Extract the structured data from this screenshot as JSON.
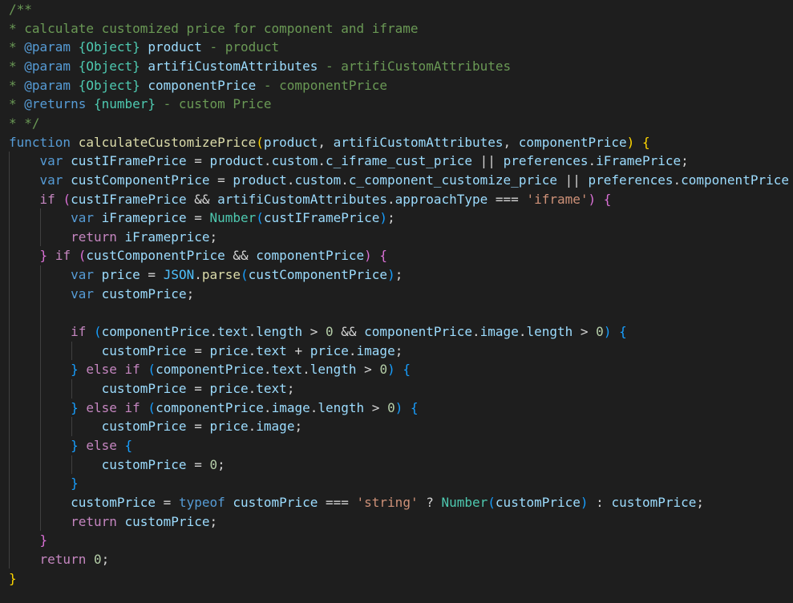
{
  "editor": {
    "theme_colors": {
      "background": "#1e1e1e",
      "comment": "#6a9955",
      "keyword": "#569cd6",
      "control": "#c586c0",
      "function": "#dcdcaa",
      "variable": "#9cdcfe",
      "string": "#ce9178",
      "number": "#b5cea8",
      "type": "#4ec9b0",
      "bracket_level_1": "#ffd700",
      "bracket_level_2": "#da70d6",
      "bracket_level_3": "#179fff"
    },
    "lines": [
      [
        [
          "/**",
          "comment"
        ]
      ],
      [
        [
          "* calculate customized price for component and iframe",
          "comment"
        ]
      ],
      [
        [
          "* ",
          "comment"
        ],
        [
          "@param",
          "keyword"
        ],
        [
          " ",
          "comment"
        ],
        [
          "{Object}",
          "type"
        ],
        [
          " ",
          "comment"
        ],
        [
          "product",
          "var"
        ],
        [
          " - product",
          "comment"
        ]
      ],
      [
        [
          "* ",
          "comment"
        ],
        [
          "@param",
          "keyword"
        ],
        [
          " ",
          "comment"
        ],
        [
          "{Object}",
          "type"
        ],
        [
          " ",
          "comment"
        ],
        [
          "artifiCustomAttributes",
          "var"
        ],
        [
          " - artifiCustomAttributes",
          "comment"
        ]
      ],
      [
        [
          "* ",
          "comment"
        ],
        [
          "@param",
          "keyword"
        ],
        [
          " ",
          "comment"
        ],
        [
          "{Object}",
          "type"
        ],
        [
          " ",
          "comment"
        ],
        [
          "componentPrice",
          "var"
        ],
        [
          " - componentPrice",
          "comment"
        ]
      ],
      [
        [
          "* ",
          "comment"
        ],
        [
          "@returns",
          "keyword"
        ],
        [
          " ",
          "comment"
        ],
        [
          "{number}",
          "type"
        ],
        [
          " - custom Price",
          "comment"
        ]
      ],
      [
        [
          "* */",
          "comment"
        ]
      ],
      [
        [
          "function",
          "keyword"
        ],
        [
          " ",
          "plain"
        ],
        [
          "calculateCustomizePrice",
          "func"
        ],
        [
          "(",
          "bracket1"
        ],
        [
          "product",
          "var"
        ],
        [
          ", ",
          "plain"
        ],
        [
          "artifiCustomAttributes",
          "var"
        ],
        [
          ", ",
          "plain"
        ],
        [
          "componentPrice",
          "var"
        ],
        [
          ")",
          "bracket1"
        ],
        [
          " ",
          "plain"
        ],
        [
          "{",
          "bracket1"
        ]
      ],
      [
        [
          "    ",
          "plain"
        ],
        [
          "var",
          "keyword"
        ],
        [
          " ",
          "plain"
        ],
        [
          "custIFramePrice",
          "var"
        ],
        [
          " = ",
          "plain"
        ],
        [
          "product",
          "var"
        ],
        [
          ".",
          "plain"
        ],
        [
          "custom",
          "var"
        ],
        [
          ".",
          "plain"
        ],
        [
          "c_iframe_cust_price",
          "var"
        ],
        [
          " || ",
          "plain"
        ],
        [
          "preferences",
          "var"
        ],
        [
          ".",
          "plain"
        ],
        [
          "iFramePrice",
          "var"
        ],
        [
          ";",
          "plain"
        ]
      ],
      [
        [
          "    ",
          "plain"
        ],
        [
          "var",
          "keyword"
        ],
        [
          " ",
          "plain"
        ],
        [
          "custComponentPrice",
          "var"
        ],
        [
          " = ",
          "plain"
        ],
        [
          "product",
          "var"
        ],
        [
          ".",
          "plain"
        ],
        [
          "custom",
          "var"
        ],
        [
          ".",
          "plain"
        ],
        [
          "c_component_customize_price",
          "var"
        ],
        [
          " || ",
          "plain"
        ],
        [
          "preferences",
          "var"
        ],
        [
          ".",
          "plain"
        ],
        [
          "componentPrice",
          "var"
        ]
      ],
      [
        [
          "    ",
          "plain"
        ],
        [
          "if",
          "control"
        ],
        [
          " ",
          "plain"
        ],
        [
          "(",
          "bracket2"
        ],
        [
          "custIFramePrice",
          "var"
        ],
        [
          " && ",
          "plain"
        ],
        [
          "artifiCustomAttributes",
          "var"
        ],
        [
          ".",
          "plain"
        ],
        [
          "approachType",
          "var"
        ],
        [
          " === ",
          "plain"
        ],
        [
          "'iframe'",
          "string"
        ],
        [
          ")",
          "bracket2"
        ],
        [
          " ",
          "plain"
        ],
        [
          "{",
          "bracket2"
        ]
      ],
      [
        [
          "        ",
          "plain"
        ],
        [
          "var",
          "keyword"
        ],
        [
          " ",
          "plain"
        ],
        [
          "iFrameprice",
          "var"
        ],
        [
          " = ",
          "plain"
        ],
        [
          "Number",
          "type"
        ],
        [
          "(",
          "bracket3"
        ],
        [
          "custIFramePrice",
          "var"
        ],
        [
          ")",
          "bracket3"
        ],
        [
          ";",
          "plain"
        ]
      ],
      [
        [
          "        ",
          "plain"
        ],
        [
          "return",
          "control"
        ],
        [
          " ",
          "plain"
        ],
        [
          "iFrameprice",
          "var"
        ],
        [
          ";",
          "plain"
        ]
      ],
      [
        [
          "    ",
          "plain"
        ],
        [
          "}",
          "bracket2"
        ],
        [
          " ",
          "plain"
        ],
        [
          "if",
          "control"
        ],
        [
          " ",
          "plain"
        ],
        [
          "(",
          "bracket2"
        ],
        [
          "custComponentPrice",
          "var"
        ],
        [
          " && ",
          "plain"
        ],
        [
          "componentPrice",
          "var"
        ],
        [
          ")",
          "bracket2"
        ],
        [
          " ",
          "plain"
        ],
        [
          "{",
          "bracket2"
        ]
      ],
      [
        [
          "        ",
          "plain"
        ],
        [
          "var",
          "keyword"
        ],
        [
          " ",
          "plain"
        ],
        [
          "price",
          "var"
        ],
        [
          " = ",
          "plain"
        ],
        [
          "JSON",
          "const"
        ],
        [
          ".",
          "plain"
        ],
        [
          "parse",
          "func"
        ],
        [
          "(",
          "bracket3"
        ],
        [
          "custComponentPrice",
          "var"
        ],
        [
          ")",
          "bracket3"
        ],
        [
          ";",
          "plain"
        ]
      ],
      [
        [
          "        ",
          "plain"
        ],
        [
          "var",
          "keyword"
        ],
        [
          " ",
          "plain"
        ],
        [
          "customPrice",
          "var"
        ],
        [
          ";",
          "plain"
        ]
      ],
      [],
      [
        [
          "        ",
          "plain"
        ],
        [
          "if",
          "control"
        ],
        [
          " ",
          "plain"
        ],
        [
          "(",
          "bracket3"
        ],
        [
          "componentPrice",
          "var"
        ],
        [
          ".",
          "plain"
        ],
        [
          "text",
          "var"
        ],
        [
          ".",
          "plain"
        ],
        [
          "length",
          "var"
        ],
        [
          " > ",
          "plain"
        ],
        [
          "0",
          "number"
        ],
        [
          " && ",
          "plain"
        ],
        [
          "componentPrice",
          "var"
        ],
        [
          ".",
          "plain"
        ],
        [
          "image",
          "var"
        ],
        [
          ".",
          "plain"
        ],
        [
          "length",
          "var"
        ],
        [
          " > ",
          "plain"
        ],
        [
          "0",
          "number"
        ],
        [
          ")",
          "bracket3"
        ],
        [
          " ",
          "plain"
        ],
        [
          "{",
          "bracket3"
        ]
      ],
      [
        [
          "            ",
          "plain"
        ],
        [
          "customPrice",
          "var"
        ],
        [
          " = ",
          "plain"
        ],
        [
          "price",
          "var"
        ],
        [
          ".",
          "plain"
        ],
        [
          "text",
          "var"
        ],
        [
          " + ",
          "plain"
        ],
        [
          "price",
          "var"
        ],
        [
          ".",
          "plain"
        ],
        [
          "image",
          "var"
        ],
        [
          ";",
          "plain"
        ]
      ],
      [
        [
          "        ",
          "plain"
        ],
        [
          "}",
          "bracket3"
        ],
        [
          " ",
          "plain"
        ],
        [
          "else",
          "control"
        ],
        [
          " ",
          "plain"
        ],
        [
          "if",
          "control"
        ],
        [
          " ",
          "plain"
        ],
        [
          "(",
          "bracket3"
        ],
        [
          "componentPrice",
          "var"
        ],
        [
          ".",
          "plain"
        ],
        [
          "text",
          "var"
        ],
        [
          ".",
          "plain"
        ],
        [
          "length",
          "var"
        ],
        [
          " > ",
          "plain"
        ],
        [
          "0",
          "number"
        ],
        [
          ")",
          "bracket3"
        ],
        [
          " ",
          "plain"
        ],
        [
          "{",
          "bracket3"
        ]
      ],
      [
        [
          "            ",
          "plain"
        ],
        [
          "customPrice",
          "var"
        ],
        [
          " = ",
          "plain"
        ],
        [
          "price",
          "var"
        ],
        [
          ".",
          "plain"
        ],
        [
          "text",
          "var"
        ],
        [
          ";",
          "plain"
        ]
      ],
      [
        [
          "        ",
          "plain"
        ],
        [
          "}",
          "bracket3"
        ],
        [
          " ",
          "plain"
        ],
        [
          "else",
          "control"
        ],
        [
          " ",
          "plain"
        ],
        [
          "if",
          "control"
        ],
        [
          " ",
          "plain"
        ],
        [
          "(",
          "bracket3"
        ],
        [
          "componentPrice",
          "var"
        ],
        [
          ".",
          "plain"
        ],
        [
          "image",
          "var"
        ],
        [
          ".",
          "plain"
        ],
        [
          "length",
          "var"
        ],
        [
          " > ",
          "plain"
        ],
        [
          "0",
          "number"
        ],
        [
          ")",
          "bracket3"
        ],
        [
          " ",
          "plain"
        ],
        [
          "{",
          "bracket3"
        ]
      ],
      [
        [
          "            ",
          "plain"
        ],
        [
          "customPrice",
          "var"
        ],
        [
          " = ",
          "plain"
        ],
        [
          "price",
          "var"
        ],
        [
          ".",
          "plain"
        ],
        [
          "image",
          "var"
        ],
        [
          ";",
          "plain"
        ]
      ],
      [
        [
          "        ",
          "plain"
        ],
        [
          "}",
          "bracket3"
        ],
        [
          " ",
          "plain"
        ],
        [
          "else",
          "control"
        ],
        [
          " ",
          "plain"
        ],
        [
          "{",
          "bracket3"
        ]
      ],
      [
        [
          "            ",
          "plain"
        ],
        [
          "customPrice",
          "var"
        ],
        [
          " = ",
          "plain"
        ],
        [
          "0",
          "number"
        ],
        [
          ";",
          "plain"
        ]
      ],
      [
        [
          "        ",
          "plain"
        ],
        [
          "}",
          "bracket3"
        ]
      ],
      [
        [
          "        ",
          "plain"
        ],
        [
          "customPrice",
          "var"
        ],
        [
          " = ",
          "plain"
        ],
        [
          "typeof",
          "keyword"
        ],
        [
          " ",
          "plain"
        ],
        [
          "customPrice",
          "var"
        ],
        [
          " === ",
          "plain"
        ],
        [
          "'string'",
          "string"
        ],
        [
          " ? ",
          "plain"
        ],
        [
          "Number",
          "type"
        ],
        [
          "(",
          "bracket3"
        ],
        [
          "customPrice",
          "var"
        ],
        [
          ")",
          "bracket3"
        ],
        [
          " : ",
          "plain"
        ],
        [
          "customPrice",
          "var"
        ],
        [
          ";",
          "plain"
        ]
      ],
      [
        [
          "        ",
          "plain"
        ],
        [
          "return",
          "control"
        ],
        [
          " ",
          "plain"
        ],
        [
          "customPrice",
          "var"
        ],
        [
          ";",
          "plain"
        ]
      ],
      [
        [
          "    ",
          "plain"
        ],
        [
          "}",
          "bracket2"
        ]
      ],
      [
        [
          "    ",
          "plain"
        ],
        [
          "return",
          "control"
        ],
        [
          " ",
          "plain"
        ],
        [
          "0",
          "number"
        ],
        [
          ";",
          "plain"
        ]
      ],
      [
        [
          "}",
          "bracket1"
        ]
      ]
    ]
  }
}
